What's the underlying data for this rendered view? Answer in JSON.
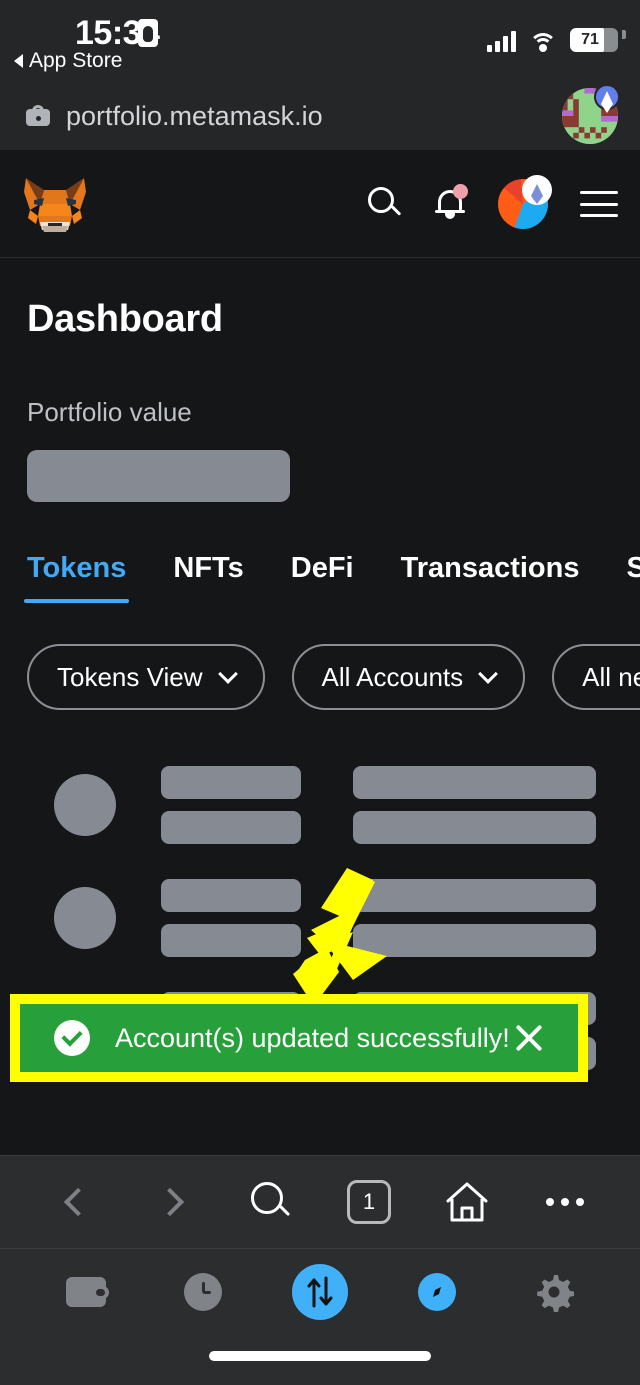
{
  "status_bar": {
    "time": "15:34",
    "back_app_label": "App Store",
    "battery_percent": "71",
    "battery_level": 71,
    "record_icon": "id-badge-icon",
    "signal_icon": "cellular-signal-icon",
    "wifi_icon": "wifi-icon"
  },
  "browser": {
    "url": "portfolio.metamask.io",
    "lock_icon": "lock-icon",
    "profile_icon": "account-identicon",
    "toolbar": {
      "back_label": "Back",
      "forward_label": "Forward",
      "search_label": "Search",
      "tab_count": "1",
      "home_label": "Home",
      "more_label": "More"
    }
  },
  "app_header": {
    "logo": "metamask-fox-logo",
    "search_icon": "search-icon",
    "notifications_icon": "bell-icon",
    "notifications_badge": true,
    "account_icon": "account-avatar",
    "network_badge": "ethereum-icon",
    "menu_icon": "hamburger-menu-icon"
  },
  "page": {
    "title": "Dashboard",
    "portfolio_label": "Portfolio value",
    "portfolio_value": "",
    "tabs": [
      {
        "label": "Tokens",
        "active": true
      },
      {
        "label": "NFTs",
        "active": false
      },
      {
        "label": "DeFi",
        "active": false
      },
      {
        "label": "Transactions",
        "active": false
      },
      {
        "label": "Spen",
        "active": false
      }
    ],
    "filters": [
      {
        "label": "Tokens View"
      },
      {
        "label": "All Accounts"
      },
      {
        "label": "All ne"
      }
    ],
    "loading_rows": 3
  },
  "toast": {
    "message": "Account(s) updated successfully!",
    "icon": "check-circle-icon",
    "close_icon": "close-icon",
    "background_color": "#27a03c",
    "highlight_color": "#ffff00"
  },
  "annotation": {
    "arrow_color": "#ffff00",
    "arrow_icon": "down-left-arrow-annotation"
  },
  "app_tabbar": {
    "items": [
      {
        "name": "wallet",
        "active": false
      },
      {
        "name": "activity",
        "active": false
      },
      {
        "name": "swap",
        "active": true
      },
      {
        "name": "browser",
        "active": true
      },
      {
        "name": "settings",
        "active": false
      }
    ]
  },
  "colors": {
    "accent_blue": "#43a9f5",
    "success_green": "#27a03c",
    "highlight_yellow": "#ffff00",
    "page_bg": "#141618",
    "chrome_bg": "#242628",
    "skeleton": "#868a93"
  }
}
